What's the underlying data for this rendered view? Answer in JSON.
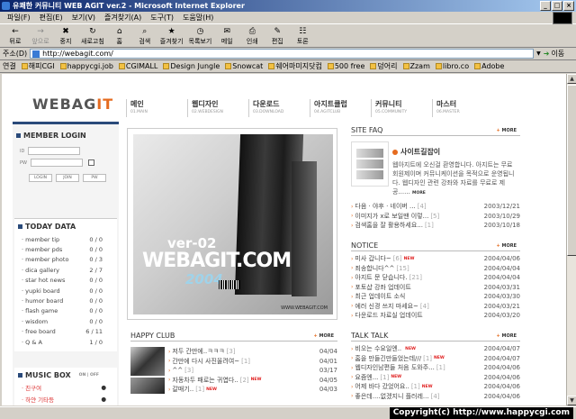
{
  "window": {
    "title": "유쾌한 커뮤니티 WEB AGIT ver.2 - Microsoft Internet Explorer"
  },
  "menu": [
    "파일(F)",
    "편집(E)",
    "보기(V)",
    "즐겨찾기(A)",
    "도구(T)",
    "도움말(H)"
  ],
  "toolbar": [
    {
      "label": "뒤로",
      "icon": "←",
      "enabled": true
    },
    {
      "label": "앞으로",
      "icon": "→",
      "enabled": false
    },
    {
      "label": "중지",
      "icon": "✖",
      "enabled": true
    },
    {
      "label": "새로고침",
      "icon": "↻",
      "enabled": true
    },
    {
      "label": "홈",
      "icon": "⌂",
      "enabled": true
    },
    {
      "label": "검색",
      "icon": "⌕",
      "enabled": true
    },
    {
      "label": "즐겨찾기",
      "icon": "★",
      "enabled": true
    },
    {
      "label": "목록보기",
      "icon": "◷",
      "enabled": true
    },
    {
      "label": "메일",
      "icon": "✉",
      "enabled": true
    },
    {
      "label": "인쇄",
      "icon": "⎙",
      "enabled": true
    },
    {
      "label": "편집",
      "icon": "✎",
      "enabled": true
    },
    {
      "label": "토론",
      "icon": "☷",
      "enabled": true
    }
  ],
  "address": {
    "label": "주소(D)",
    "url": "http://webagit.com/",
    "go": "이동"
  },
  "links": {
    "label": "연결",
    "items": [
      "해피CGI",
      "happycgi.job",
      "CGIMALL",
      "Design Jungle",
      "Snowcat",
      "쉐어마미지닷컴",
      "500 free",
      "덩어리",
      "Zzam",
      "libro.co",
      "Adobe"
    ]
  },
  "site": {
    "logo_a": "WEBAG",
    "logo_b": "IT",
    "nav": [
      {
        "k": "메인",
        "e": "01.MAIN"
      },
      {
        "k": "웹디자인",
        "e": "02.WEBDESIGN"
      },
      {
        "k": "다운로드",
        "e": "03.DOWNLOAD"
      },
      {
        "k": "아지트클럽",
        "e": "04.AGITCLUB"
      },
      {
        "k": "커뮤니티",
        "e": "05.COMMUNITY"
      },
      {
        "k": "마스터",
        "e": "06.MASTER"
      }
    ],
    "login": {
      "title": "MEMBER LOGIN",
      "id_label": "ID",
      "pw_label": "PW",
      "buttons": [
        "LOGIN",
        "JOIN",
        "PW"
      ]
    },
    "today": {
      "title": "TODAY DATA",
      "rows": [
        {
          "name": "member tip",
          "val": "0 / 0"
        },
        {
          "name": "member pds",
          "val": "0 / 0"
        },
        {
          "name": "member photo",
          "val": "0 / 3"
        },
        {
          "name": "dica gallery",
          "val": "2 / 7"
        },
        {
          "name": "star hot news",
          "val": "0 / 0"
        },
        {
          "name": "yupki board",
          "val": "0 / 0"
        },
        {
          "name": "humor board",
          "val": "0 / 0"
        },
        {
          "name": "flash game",
          "val": "0 / 0"
        },
        {
          "name": "wisdom",
          "val": "0 / 0"
        },
        {
          "name": "free board",
          "val": "6 / 11"
        },
        {
          "name": "Q & A",
          "val": "1 / 0"
        }
      ]
    },
    "music": {
      "title": "MUSIC BOX",
      "onoff": "ON | OFF",
      "rows": [
        {
          "name": "친구여",
          "ico": "●"
        },
        {
          "name": "하얀 기타등",
          "ico": "●"
        }
      ]
    },
    "hero": {
      "ver": "ver-02",
      "brand": "WEBAGIT.COM",
      "year": "2004",
      "url": "WWW.WEBAGIT.COM"
    },
    "faq": {
      "title": "SITE FAQ",
      "more": "MORE",
      "sub": "사이트길잡이",
      "text": "웹아지트에 오신걸 환영합니다. 아지트는 무료회원제이며 커뮤니케이션을 목적으로 운영됩니다. 웹디자인 관련 강좌와 자료를 무료로 제공......",
      "text_more": "MORE",
      "rows": [
        {
          "t": "다음 · 야후 · 네이버 ...",
          "n": "[4]",
          "new": "",
          "d": "2003/12/21"
        },
        {
          "t": "이미지가 x로 보일땐 이렇...",
          "n": "[5]",
          "new": "",
          "d": "2003/10/29"
        },
        {
          "t": "검색홈을 잘 활용하세요...",
          "n": "[1]",
          "new": "",
          "d": "2003/10/18"
        }
      ]
    },
    "notice": {
      "title": "NOTICE",
      "more": "MORE",
      "rows": [
        {
          "t": "미사 갑니다~",
          "n": "[6]",
          "new": "NEW",
          "d": "2004/04/06"
        },
        {
          "t": "죄송합니다^^",
          "n": "[15]",
          "new": "",
          "d": "2004/04/04"
        },
        {
          "t": "아지트 문 닫습니다.",
          "n": "[21]",
          "new": "",
          "d": "2004/04/04"
        },
        {
          "t": "포토샵 강좌 업데이트",
          "n": "",
          "new": "",
          "d": "2004/03/31"
        },
        {
          "t": "최근 업데이트 소식",
          "n": "",
          "new": "",
          "d": "2004/03/30"
        },
        {
          "t": "에러 신경 쓰지 마세요~",
          "n": "[4]",
          "new": "",
          "d": "2004/03/21"
        },
        {
          "t": "다운로드 자료실 업데이트",
          "n": "",
          "new": "",
          "d": "2004/03/20"
        }
      ]
    },
    "happy": {
      "title": "HAPPY CLUB",
      "more": "MORE",
      "rows": [
        {
          "t": "저두 간만에..ㅋㅋㅋ",
          "n": "[3]",
          "new": "",
          "d": "04/04"
        },
        {
          "t": "간만에 다시 사진올려여~",
          "n": "[1]",
          "new": "",
          "d": "04/01"
        },
        {
          "t": "^^",
          "n": "[3]",
          "new": "",
          "d": "03/17"
        },
        {
          "t": "자동차두 패로는 귀엽다..",
          "n": "[2]",
          "new": "NEW",
          "d": "04/05"
        },
        {
          "t": "갈매기..",
          "n": "[1]",
          "new": "NEW",
          "d": "04/03"
        }
      ]
    },
    "talk": {
      "title": "TALK TALK",
      "more": "MORE",
      "rows": [
        {
          "t": "비오는 수요일엔..",
          "n": "",
          "new": "NEW",
          "d": "2004/04/07"
        },
        {
          "t": "홈을 만들긴만들었는데///",
          "n": "[1]",
          "new": "NEW",
          "d": "2004/04/07"
        },
        {
          "t": "웹디자인남편들 처음 도와주...",
          "n": "[1]",
          "new": "",
          "d": "2004/04/06"
        },
        {
          "t": "요즘엔...",
          "n": "[1]",
          "new": "NEW",
          "d": "2004/04/06"
        },
        {
          "t": "어제 바다 갔었어요..",
          "n": "[1]",
          "new": "NEW",
          "d": "2004/04/06"
        },
        {
          "t": "좋은데....없겠지니 플러레...",
          "n": "[4]",
          "new": "",
          "d": "2004/04/06"
        }
      ]
    }
  },
  "status": {
    "copyright": "Copyright(c) http://www.happycgi.com"
  }
}
